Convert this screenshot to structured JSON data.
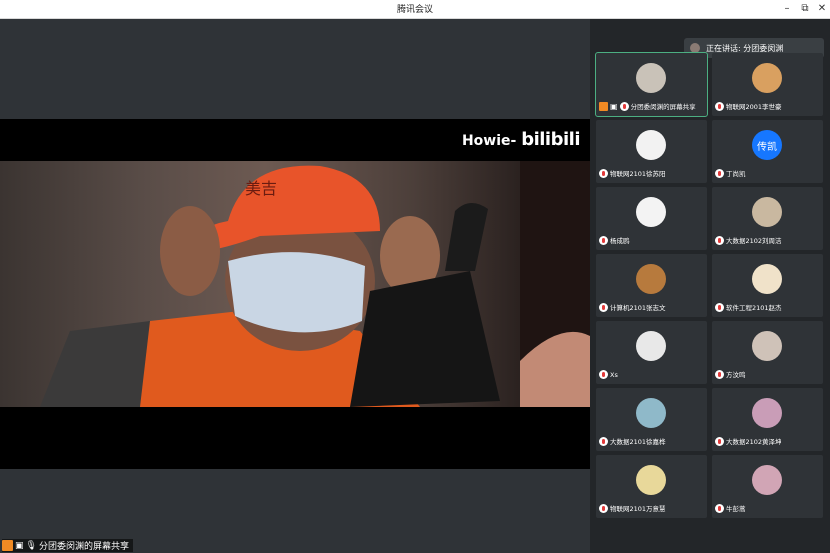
{
  "window": {
    "title": "腾讯会议",
    "minimize": "–",
    "maximize": "⧉",
    "close": "✕"
  },
  "stage": {
    "watermark_text": "Howie-",
    "watermark_logo": "bilibili",
    "share_label": "分团委闵渊的屏幕共享"
  },
  "speaking": {
    "text": "正在讲话: 分团委闵渊"
  },
  "participants": [
    {
      "name": "分团委闵渊的屏幕共享",
      "avatar_color": "#c9c2b8",
      "avatar_text": "",
      "active": true
    },
    {
      "name": "物联网2001李世豪",
      "avatar_color": "#d9a060",
      "avatar_text": ""
    },
    {
      "name": "物联网2101徐苏阳",
      "avatar_color": "#f2f2f2",
      "avatar_text": ""
    },
    {
      "name": "丁尚凯",
      "avatar_color": "#1677ff",
      "avatar_text": "传凯"
    },
    {
      "name": "杨成鸥",
      "avatar_color": "#f3f3f3",
      "avatar_text": ""
    },
    {
      "name": "大数据2102刘周洁",
      "avatar_color": "#c9b8a0",
      "avatar_text": ""
    },
    {
      "name": "计算机2101张志文",
      "avatar_color": "#b77a3d",
      "avatar_text": ""
    },
    {
      "name": "软件工程2101赵杰",
      "avatar_color": "#f0e2c9",
      "avatar_text": ""
    },
    {
      "name": "Xs",
      "avatar_color": "#e8e8e8",
      "avatar_text": ""
    },
    {
      "name": "方汶鸣",
      "avatar_color": "#cfc2b8",
      "avatar_text": ""
    },
    {
      "name": "大数据2101徐嘉桦",
      "avatar_color": "#8fb9c9",
      "avatar_text": ""
    },
    {
      "name": "大数据2102黄泽坤",
      "avatar_color": "#c99db7",
      "avatar_text": ""
    },
    {
      "name": "物联网2101万意慧",
      "avatar_color": "#e8d89a",
      "avatar_text": ""
    },
    {
      "name": "牛彭蒿",
      "avatar_color": "#d1a5b5",
      "avatar_text": ""
    }
  ],
  "colors": {
    "accent": "#4caf82",
    "muted_mic": "#e23b3b",
    "share_orange": "#f08a24"
  }
}
